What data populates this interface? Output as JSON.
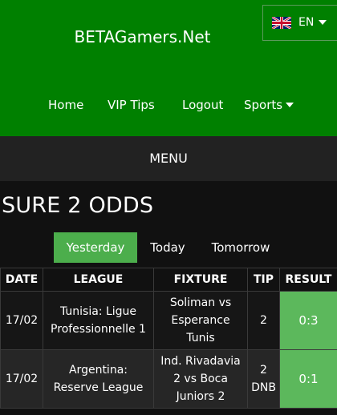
{
  "header": {
    "brand": "BETAGamers.Net",
    "language": {
      "label": "EN",
      "flag_icon": "uk-flag-icon"
    },
    "nav": [
      {
        "label": "Home"
      },
      {
        "label": "VIP Tips"
      },
      {
        "label": "Logout"
      },
      {
        "label": "Sports",
        "has_dropdown": true
      }
    ]
  },
  "menu": {
    "label": "MENU"
  },
  "page": {
    "title": "SURE 2 ODDS"
  },
  "tabs": [
    {
      "label": "Yesterday",
      "active": true
    },
    {
      "label": "Today",
      "active": false
    },
    {
      "label": "Tomorrow",
      "active": false
    }
  ],
  "table": {
    "columns": [
      "DATE",
      "LEAGUE",
      "FIXTURE",
      "TIP",
      "RESULT"
    ],
    "rows": [
      {
        "date": "17/02",
        "league": "Tunisia: Ligue Professionnelle 1",
        "fixture": "Soliman vs Esperance Tunis",
        "tip": "2",
        "result": "0:3"
      },
      {
        "date": "17/02",
        "league": "Argentina: Reserve League",
        "fixture": "Ind. Rivadavia 2 vs Boca Juniors 2",
        "tip": "2 DNB",
        "result": "0:1"
      }
    ]
  },
  "colors": {
    "header_green": "#008000",
    "menu_bar": "#222222",
    "active_tab": "#4cae4c",
    "result_cell": "#5cb85c",
    "background": "#111111"
  }
}
